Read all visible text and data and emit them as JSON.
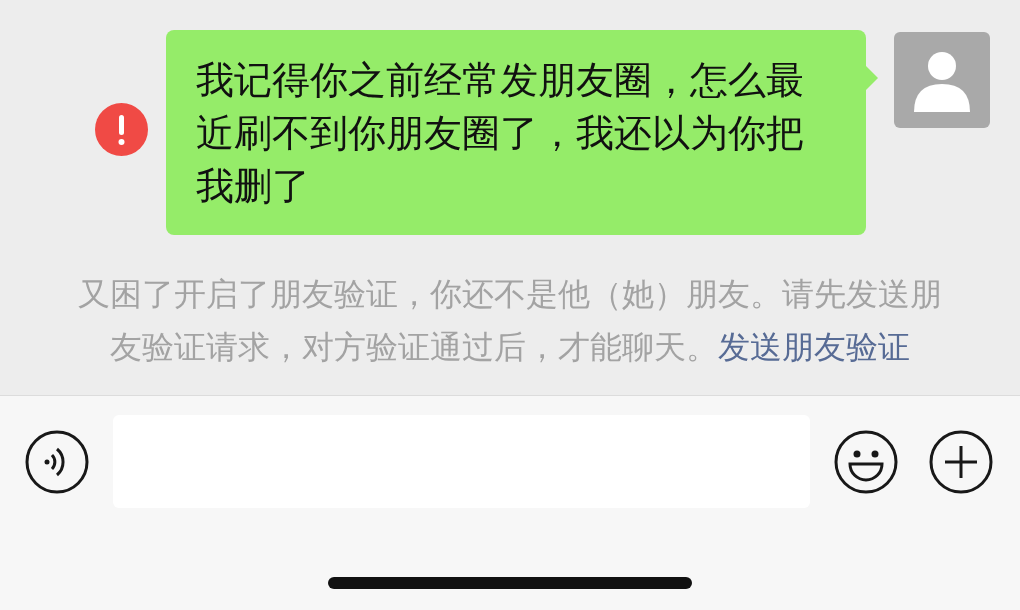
{
  "messages": [
    {
      "text": "我记得你之前经常发朋友圈，怎么最近刷不到你朋友圈了，我还以为你把我删了",
      "failed": true,
      "outgoing": true
    }
  ],
  "system_notice": {
    "text": "又困了开启了朋友验证，你还不是他（她）朋友。请先发送朋友验证请求，对方验证通过后，才能聊天。",
    "link": "发送朋友验证"
  }
}
